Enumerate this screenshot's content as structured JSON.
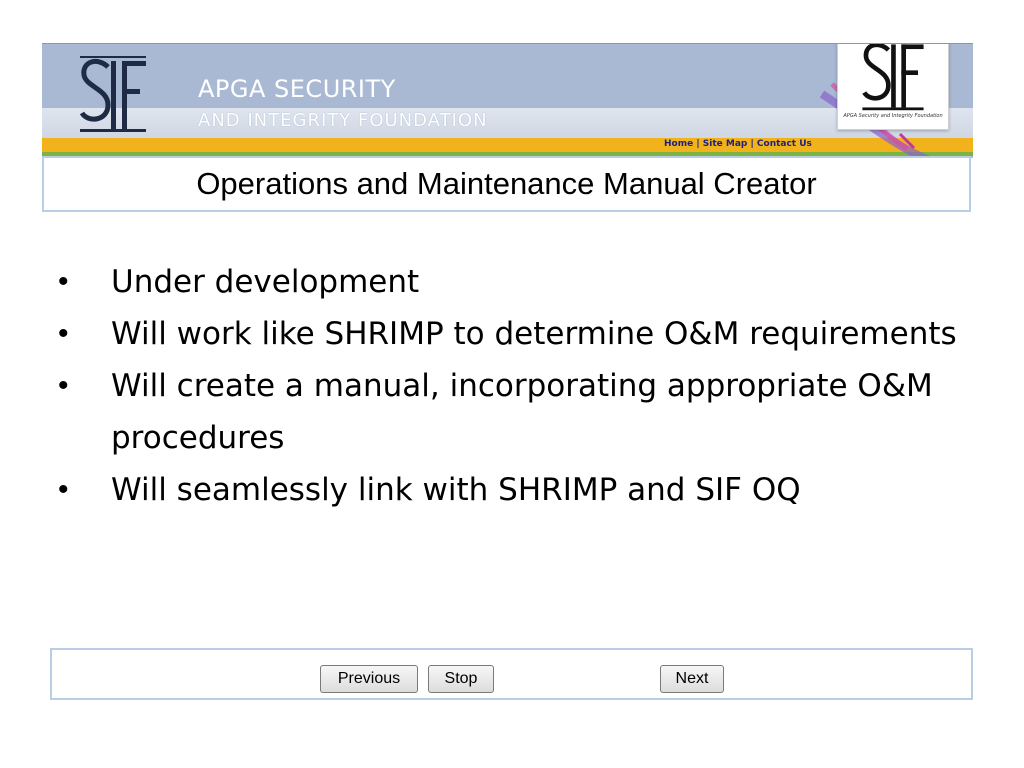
{
  "banner": {
    "org_line1": "APGA SECURITY",
    "org_line2": "AND INTEGRITY FOUNDATION",
    "nav_links": [
      "Home",
      "Site Map",
      "Contact Us"
    ],
    "nav_separator": " | ",
    "logo_caption": "APGA Security and Integrity Foundation",
    "colors": {
      "banner_blue": "#a9b9d3",
      "stripe_orange": "#f2b21c",
      "stripe_green": "#7cb342",
      "logo_navy": "#1f2a44"
    }
  },
  "slide": {
    "title": "Operations and Maintenance Manual Creator",
    "bullets": [
      "Under development",
      "Will work like SHRIMP to determine O&M requirements",
      "Will create a manual, incorporating appropriate O&M procedures",
      "Will seamlessly link with SHRIMP and SIF OQ"
    ],
    "bullet_symbol": "•"
  },
  "navigation": {
    "previous_label": "Previous",
    "stop_label": "Stop",
    "next_label": "Next"
  }
}
